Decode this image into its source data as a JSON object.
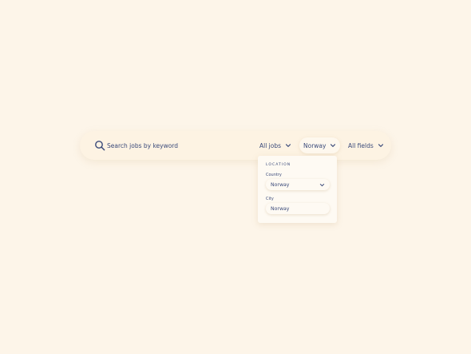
{
  "search": {
    "placeholder": "Search jobs by keyword"
  },
  "filters": {
    "jobs_label": "All jobs",
    "country_label": "Norway",
    "fields_label": "All fields"
  },
  "location_dropdown": {
    "heading": "LOCATION",
    "country_label": "Country",
    "country_value": "Norway",
    "city_label": "City",
    "city_value": "Norway"
  },
  "icons": {
    "search": "search-icon",
    "chevron": "chevron-down-icon"
  },
  "colors": {
    "background": "#fdf5e9",
    "text": "#3a4a7a"
  }
}
